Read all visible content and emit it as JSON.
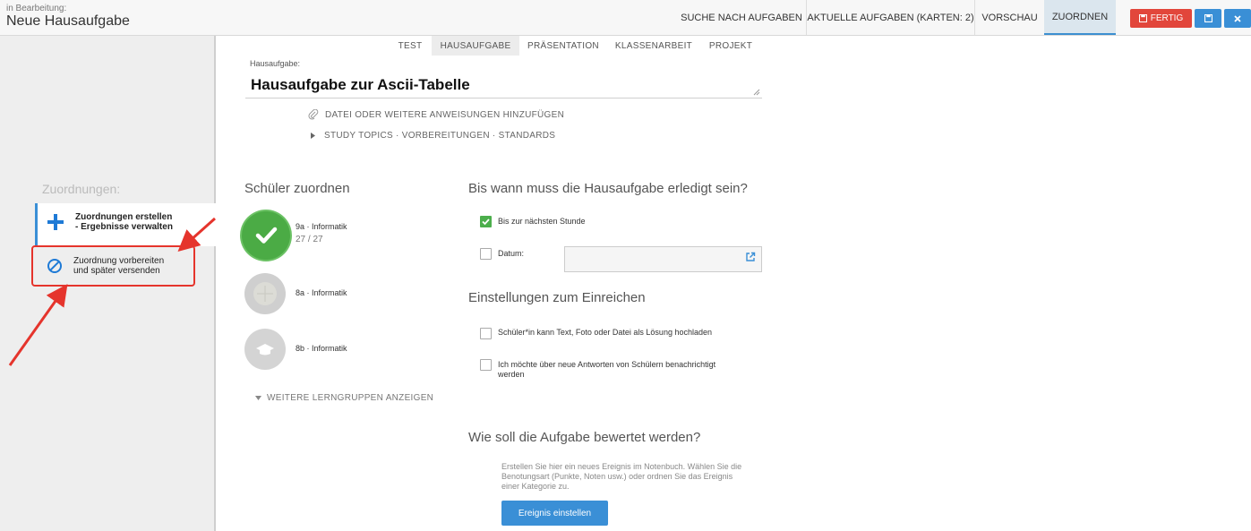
{
  "header": {
    "status_label": "in Bearbeitung:",
    "title": "Neue Hausaufgabe",
    "nav": [
      "SUCHE NACH AUFGABEN",
      "AKTUELLE AUFGABEN (KARTEN: 2)",
      "VORSCHAU",
      "ZUORDNEN"
    ],
    "active_nav": "ZUORDNEN",
    "done_label": "FERTIG",
    "save_icon": "save-icon",
    "close_icon": "close-icon",
    "colors": {
      "done": "#e2463b",
      "primary": "#3a8fd6"
    }
  },
  "sidebar": {
    "heading": "Zuordnungen:",
    "items": [
      {
        "line1": "Zuordnungen erstellen",
        "line2": "- Ergebnisse verwalten",
        "icon": "plus-icon",
        "active": true
      },
      {
        "line1": "Zuordnung vorbereiten",
        "line2": "und später versenden",
        "icon": "ban-icon",
        "active": false
      }
    ]
  },
  "type_tabs": [
    "TEST",
    "HAUSAUFGABE",
    "PRÄSENTATION",
    "KLASSENARBEIT",
    "PROJEKT"
  ],
  "active_type_tab": "HAUSAUFGABE",
  "assignment": {
    "field_label": "Hausaufgabe:",
    "title": "Hausaufgabe zur Ascii-Tabelle",
    "attach_label": "DATEI ODER WEITERE ANWEISUNGEN HINZUFÜGEN",
    "topics_label": "STUDY TOPICS · VORBEREITUNGEN · STANDARDS"
  },
  "groups": {
    "heading": "Schüler zuordnen",
    "items": [
      {
        "name": "9a · Informatik",
        "count": "27 / 27",
        "selected": true
      },
      {
        "name": "8a · Informatik",
        "count": "",
        "selected": false
      },
      {
        "name": "8b · Informatik",
        "count": "",
        "selected": false
      }
    ],
    "more_label": "WEITERE LERNGRUPPEN ANZEIGEN"
  },
  "due": {
    "heading": "Bis wann muss die Hausaufgabe erledigt sein?",
    "next_lesson_label": "Bis zur nächsten Stunde",
    "next_lesson_checked": true,
    "date_label": "Datum:",
    "date_checked": false
  },
  "submission": {
    "heading": "Einstellungen zum Einreichen",
    "upload_label": "Schüler*in kann Text, Foto oder Datei als Lösung hochladen",
    "notify_line1": "Ich möchte über neue Antworten von Schülern benachrichtigt",
    "notify_line2": "werden"
  },
  "grading": {
    "heading": "Wie soll die Aufgabe bewertet werden?",
    "line1": "Erstellen Sie hier ein neues Ereignis im Notenbuch. Wählen Sie die",
    "line2": "Benotungsart (Punkte, Noten usw.) oder ordnen Sie das Ereignis",
    "line3": "einer Kategorie zu.",
    "button": "Ereignis einstellen"
  }
}
